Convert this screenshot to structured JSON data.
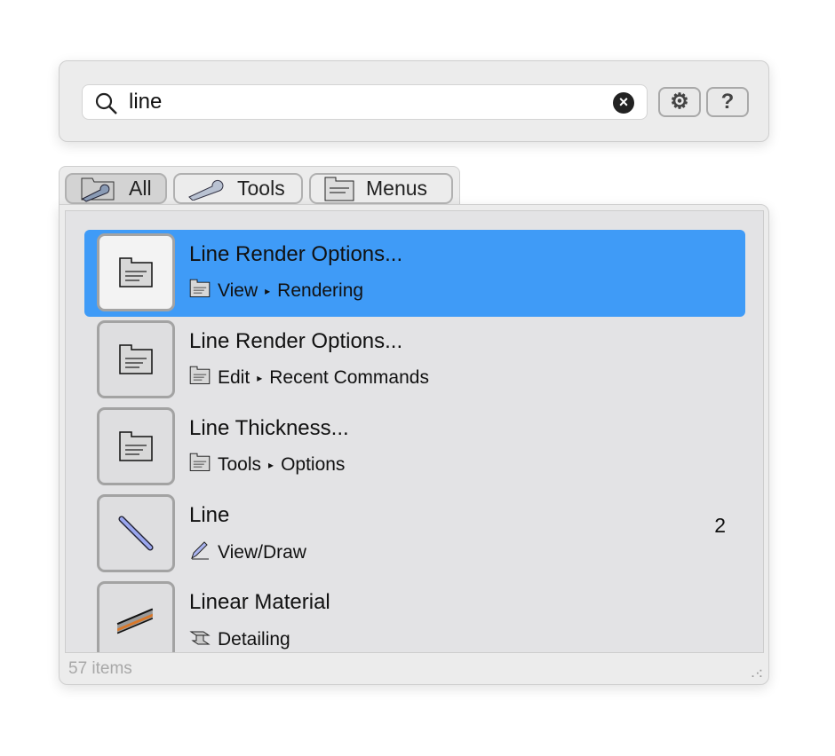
{
  "search": {
    "value": "line",
    "clear_icon": "x-circle-icon"
  },
  "buttons": {
    "settings": "gear-icon",
    "help_label": "?"
  },
  "tabs": [
    {
      "label": "All",
      "selected": true
    },
    {
      "label": "Tools"
    },
    {
      "label": "Menus"
    }
  ],
  "results": [
    {
      "title": "Line Render Options...",
      "path": [
        "View",
        "Rendering"
      ],
      "icon": "menu-folder-icon",
      "selected": true
    },
    {
      "title": "Line Render Options...",
      "path": [
        "Edit",
        "Recent Commands"
      ],
      "icon": "menu-folder-icon"
    },
    {
      "title": "Line Thickness...",
      "path": [
        "Tools",
        "Options"
      ],
      "icon": "menu-folder-icon"
    },
    {
      "title": "Line",
      "path": [
        "View/Draw"
      ],
      "icon": "line-tool-icon",
      "shortcut": "2"
    },
    {
      "title": "Linear Material",
      "path": [
        "Detailing"
      ],
      "icon": "linear-material-icon"
    }
  ],
  "separator": "▸",
  "footer": {
    "count": "57 items"
  },
  "colors": {
    "selection": "#3f9bf7"
  }
}
